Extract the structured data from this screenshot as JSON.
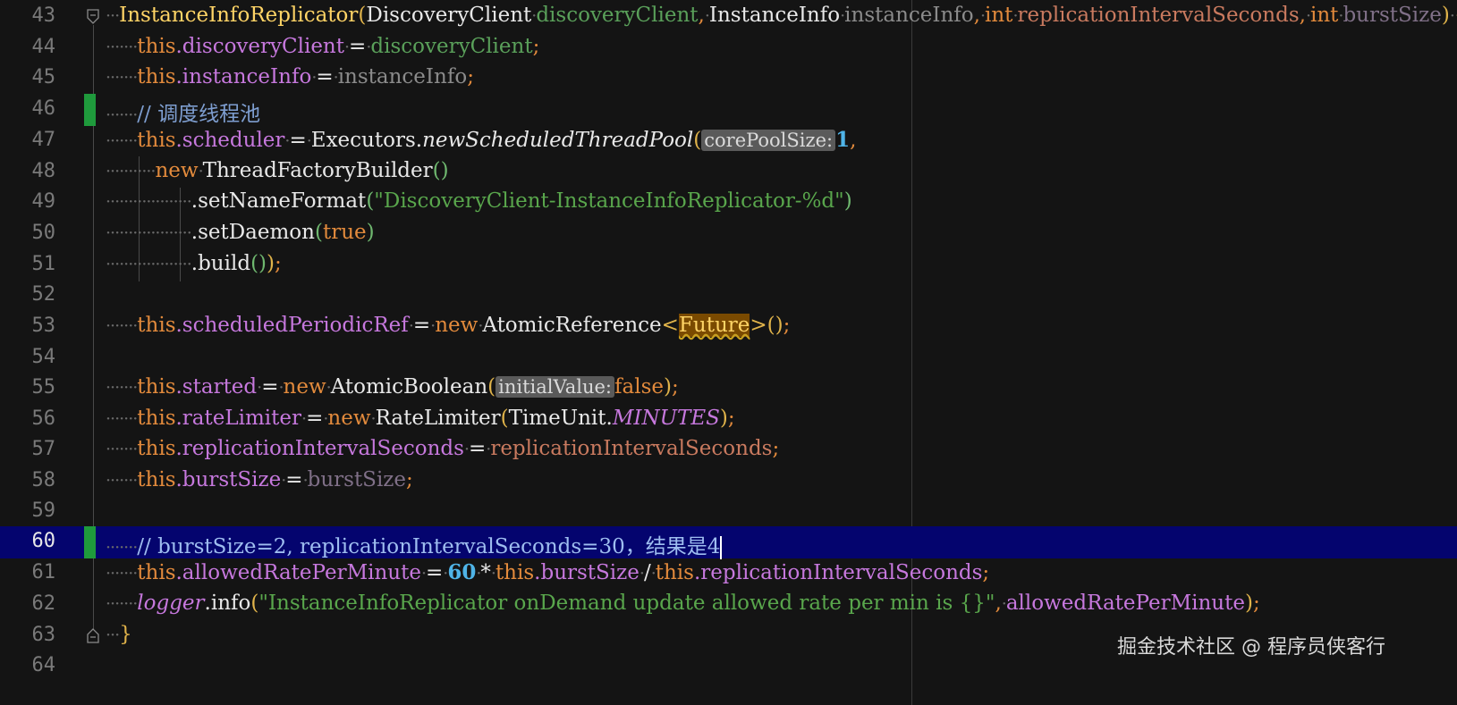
{
  "editor": {
    "current_line": "60",
    "lines": [
      {
        "num": "43",
        "tokens": [
          "InstanceInfoReplicator",
          "(",
          "DiscoveryClient",
          "discoveryClient",
          ",",
          "InstanceInfo",
          "instanceInfo",
          ",",
          "int",
          "replicationIntervalSeconds",
          ",",
          "int",
          "burstSize",
          ")",
          "{"
        ]
      },
      {
        "num": "44",
        "tokens": [
          "this",
          ".discoveryClient",
          "=",
          "discoveryClient",
          ";"
        ]
      },
      {
        "num": "45",
        "tokens": [
          "this",
          ".instanceInfo",
          "=",
          "instanceInfo",
          ";"
        ]
      },
      {
        "num": "46",
        "tokens": [
          "// 调度线程池"
        ]
      },
      {
        "num": "47",
        "tokens": [
          "this",
          ".scheduler",
          "=",
          "Executors.",
          "newScheduledThreadPool",
          "(",
          "corePoolSize:",
          "1",
          ","
        ]
      },
      {
        "num": "48",
        "tokens": [
          "new",
          "ThreadFactoryBuilder",
          "()"
        ]
      },
      {
        "num": "49",
        "tokens": [
          ".setNameFormat",
          "(",
          "\"DiscoveryClient-InstanceInfoReplicator-%d\"",
          ")"
        ]
      },
      {
        "num": "50",
        "tokens": [
          ".setDaemon",
          "(",
          "true",
          ")"
        ]
      },
      {
        "num": "51",
        "tokens": [
          ".build",
          "()",
          ")",
          ";"
        ]
      },
      {
        "num": "52",
        "tokens": []
      },
      {
        "num": "53",
        "tokens": [
          "this",
          ".scheduledPeriodicRef",
          "=",
          "new",
          "AtomicReference",
          "<",
          "Future",
          ">",
          "()",
          ";"
        ]
      },
      {
        "num": "54",
        "tokens": []
      },
      {
        "num": "55",
        "tokens": [
          "this",
          ".started",
          "=",
          "new",
          "AtomicBoolean",
          "(",
          "initialValue:",
          "false",
          ")",
          ";"
        ]
      },
      {
        "num": "56",
        "tokens": [
          "this",
          ".rateLimiter",
          "=",
          "new",
          "RateLimiter",
          "(",
          "TimeUnit.",
          "MINUTES",
          ")",
          ";"
        ]
      },
      {
        "num": "57",
        "tokens": [
          "this",
          ".replicationIntervalSeconds",
          "=",
          "replicationIntervalSeconds",
          ";"
        ]
      },
      {
        "num": "58",
        "tokens": [
          "this",
          ".burstSize",
          "=",
          "burstSize",
          ";"
        ]
      },
      {
        "num": "59",
        "tokens": []
      },
      {
        "num": "60",
        "tokens": [
          "// burstSize=2, replicationIntervalSeconds=30，结果是4"
        ]
      },
      {
        "num": "61",
        "tokens": [
          "this",
          ".allowedRatePerMinute",
          "=",
          "60",
          "*",
          "this",
          ".burstSize",
          "/",
          "this",
          ".replicationIntervalSeconds",
          ";"
        ]
      },
      {
        "num": "62",
        "tokens": [
          "logger",
          ".info",
          "(",
          "\"InstanceInfoReplicator onDemand update allowed rate per min is {}\"",
          ",",
          "allowedRatePerMinute",
          ")",
          ";"
        ]
      },
      {
        "num": "63",
        "tokens": [
          "}"
        ]
      },
      {
        "num": "64",
        "tokens": []
      }
    ]
  },
  "watermark": "掘金技术社区 @ 程序员侠客行",
  "colors": {
    "background": "#141414",
    "current_line": "#04046e",
    "keyword": "#e28a3c",
    "field": "#c678dd",
    "string": "#59a64c",
    "number": "#4fb4e8",
    "comment": "#7e9ed0",
    "change_marker": "#1f9a3c"
  }
}
